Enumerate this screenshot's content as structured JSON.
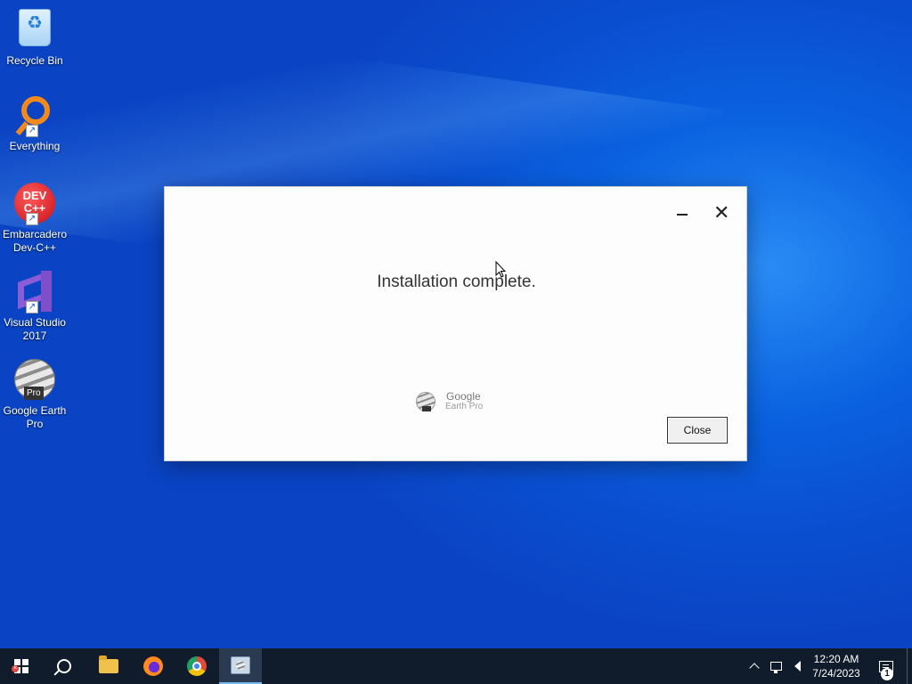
{
  "desktop": {
    "icons": [
      {
        "label": "Recycle Bin",
        "icon": "recycle-bin-icon"
      },
      {
        "label": "Everything",
        "icon": "everything-icon"
      },
      {
        "label": "Embarcadero Dev-C++",
        "icon": "devcpp-icon",
        "glyph": "DEV C++"
      },
      {
        "label": "Visual Studio 2017",
        "icon": "visual-studio-icon"
      },
      {
        "label": "Google Earth Pro",
        "icon": "google-earth-icon",
        "badge": "Pro"
      }
    ]
  },
  "dialog": {
    "message": "Installation complete.",
    "logo_brand": "Google",
    "logo_product": "Earth Pro",
    "close_button_label": "Close",
    "close_glyph": "✕"
  },
  "taskbar": {
    "apps": [
      {
        "name": "start",
        "icon": "windows-start-icon"
      },
      {
        "name": "search",
        "icon": "search-icon"
      },
      {
        "name": "file-explorer",
        "icon": "folder-icon"
      },
      {
        "name": "firefox",
        "icon": "firefox-icon"
      },
      {
        "name": "chrome",
        "icon": "chrome-icon"
      },
      {
        "name": "google-earth-installer",
        "icon": "installer-icon",
        "active": true
      }
    ],
    "clock_time": "12:20 AM",
    "clock_date": "7/24/2023",
    "notification_count": "1",
    "accent_color": "#76b9ed"
  }
}
